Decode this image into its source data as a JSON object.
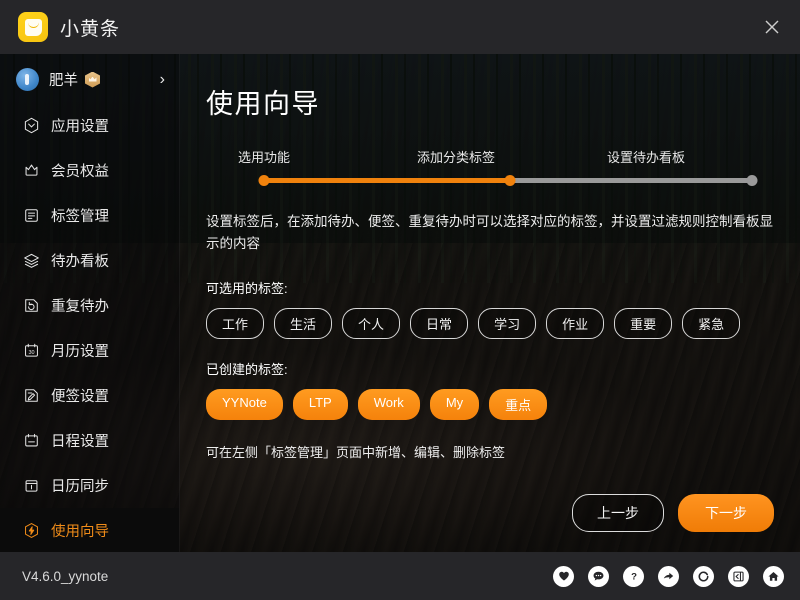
{
  "window": {
    "title": "小黄条",
    "logo_icon": "yellow-note-icon",
    "close_icon": "close-icon"
  },
  "sidebar": {
    "profile": {
      "name": "肥羊",
      "avatar_icon": "user-avatar",
      "vip_badge_icon": "vip-crown-badge",
      "chevron_icon": "chevron-right-icon"
    },
    "items": [
      {
        "label": "应用设置",
        "icon": "settings-icon",
        "active": false
      },
      {
        "label": "会员权益",
        "icon": "crown-icon",
        "active": false
      },
      {
        "label": "标签管理",
        "icon": "tag-list-icon",
        "active": false
      },
      {
        "label": "待办看板",
        "icon": "layers-icon",
        "active": false
      },
      {
        "label": "重复待办",
        "icon": "repeat-icon",
        "active": false
      },
      {
        "label": "月历设置",
        "icon": "calendar-30-icon",
        "active": false
      },
      {
        "label": "便签设置",
        "icon": "note-edit-icon",
        "active": false
      },
      {
        "label": "日程设置",
        "icon": "schedule-icon",
        "active": false
      },
      {
        "label": "日历同步",
        "icon": "calendar-sync-icon",
        "active": false
      },
      {
        "label": "使用向导",
        "icon": "lightning-icon",
        "active": true
      }
    ]
  },
  "main": {
    "page_title": "使用向导",
    "stepper": {
      "steps": [
        {
          "label": "选用功能",
          "completed": true
        },
        {
          "label": "添加分类标签",
          "completed": true
        },
        {
          "label": "设置待办看板",
          "completed": false
        }
      ],
      "current_index": 1,
      "progress_percent": 50,
      "fill_color": "#f0820d",
      "track_color": "#9a9a9a"
    },
    "description": "设置标签后，在添加待办、便签、重复待办时可以选择对应的标签，并设置过滤规则控制看板显示的内容",
    "available_tags_label": "可选用的标签:",
    "available_tags": [
      "工作",
      "生活",
      "个人",
      "日常",
      "学习",
      "作业",
      "重要",
      "紧急"
    ],
    "created_tags_label": "已创建的标签:",
    "created_tags": [
      "YYNote",
      "LTP",
      "Work",
      "My",
      "重点"
    ],
    "hint": "可在左侧「标签管理」页面中新增、编辑、删除标签",
    "buttons": {
      "prev": "上一步",
      "next": "下一步"
    }
  },
  "footer": {
    "version": "V4.6.0_yynote",
    "icons": [
      {
        "name": "heart-icon"
      },
      {
        "name": "chat-icon"
      },
      {
        "name": "help-icon"
      },
      {
        "name": "share-icon"
      },
      {
        "name": "refresh-icon"
      },
      {
        "name": "collapse-panel-icon"
      },
      {
        "name": "home-icon"
      }
    ]
  },
  "theme": {
    "accent": "#f0820d",
    "titlebar_bg": "#262629",
    "active_item_bg": "#0b0b0b"
  }
}
